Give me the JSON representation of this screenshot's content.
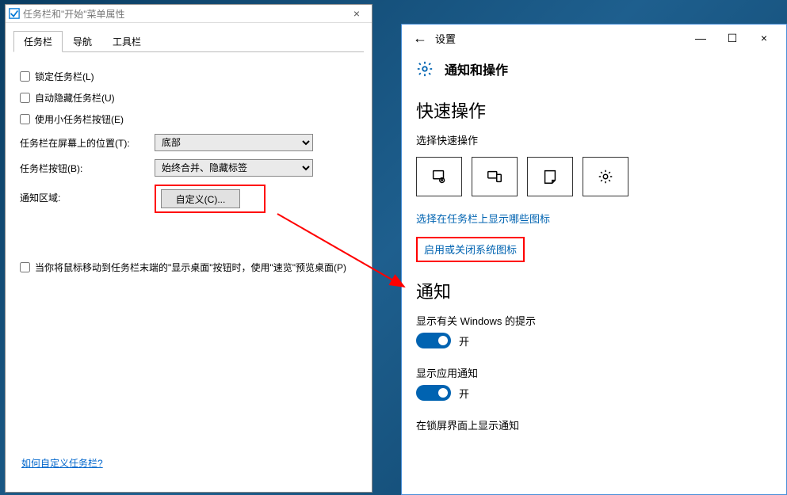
{
  "left_dialog": {
    "title": "任务栏和\"开始\"菜单属性",
    "tabs": [
      "任务栏",
      "导航",
      "工具栏"
    ],
    "active_tab": 0,
    "checks": {
      "lock": "锁定任务栏(L)",
      "autohide": "自动隐藏任务栏(U)",
      "small": "使用小任务栏按钮(E)"
    },
    "position_label": "任务栏在屏幕上的位置(T):",
    "position_value": "底部",
    "buttons_label": "任务栏按钮(B):",
    "buttons_value": "始终合并、隐藏标签",
    "notify_label": "通知区域:",
    "customize": "自定义(C)...",
    "peek_label": "当你将鼠标移动到任务栏末端的\"显示桌面\"按钮时，使用\"速览\"预览桌面(P)",
    "help_link": "如何自定义任务栏?"
  },
  "right_settings": {
    "titlebar": {
      "title": "设置"
    },
    "header": "通知和操作",
    "quick_actions": {
      "heading": "快速操作",
      "sub": "选择快速操作"
    },
    "link1": "选择在任务栏上显示哪些图标",
    "link2": "启用或关闭系统图标",
    "notifications": {
      "heading": "通知",
      "windows_tips": {
        "label": "显示有关 Windows 的提示",
        "state": "开"
      },
      "app_notify": {
        "label": "显示应用通知",
        "state": "开"
      },
      "lock_screen": {
        "label": "在锁屏界面上显示通知"
      }
    }
  }
}
